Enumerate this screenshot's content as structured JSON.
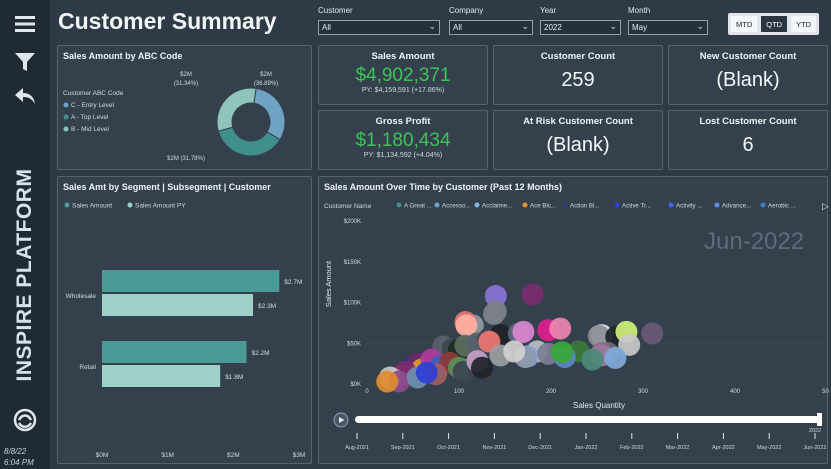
{
  "header": {
    "title": "Customer Summary"
  },
  "sidebar": {
    "brand": "INSPIRE PLATFORM",
    "date": "8/8/22",
    "time": "6:04 PM"
  },
  "filters": [
    {
      "label": "Customer",
      "value": "All"
    },
    {
      "label": "Company",
      "value": "All"
    },
    {
      "label": "Year",
      "value": "2022"
    },
    {
      "label": "Month",
      "value": "May"
    }
  ],
  "period_toggle": {
    "options": [
      "MTD",
      "QTD",
      "YTD"
    ],
    "selected": "QTD"
  },
  "cards": {
    "sales_amount": {
      "title": "Sales Amount",
      "value": "$4,902,371",
      "sub": "PY: $4,159,591 (+17.86%)"
    },
    "gross_profit": {
      "title": "Gross Profit",
      "value": "$1,180,434",
      "sub": "PY: $1,134,592 (+4.04%)"
    },
    "customer_count": {
      "title": "Customer Count",
      "value": "259"
    },
    "new_customer_count": {
      "title": "New Customer Count",
      "value": "(Blank)"
    },
    "at_risk_customer_count": {
      "title": "At Risk Customer Count",
      "value": "(Blank)"
    },
    "lost_customer_count": {
      "title": "Lost Customer Count",
      "value": "6"
    }
  },
  "donut": {
    "title": "Sales Amount by ABC Code",
    "legend_title": "Customer ABC Code",
    "labels": [
      {
        "value": "$2M",
        "pct": "(31.34%)"
      },
      {
        "value": "$2M",
        "pct": "(36.89%)"
      },
      {
        "value": "$2M (31.78%)",
        "pct": ""
      }
    ]
  },
  "scatter_panel": {
    "title": "Sales Amount Over Time by Customer (Past 12 Months)",
    "legend_label": "Customer Name",
    "watermark": "Jun-2022",
    "timeline": [
      "Aug-2021",
      "Sep-2021",
      "Oct-2021",
      "Nov-2021",
      "Dec-2021",
      "Jan-2022",
      "Feb-2022",
      "Mar-2022",
      "Apr-2022",
      "May-2022",
      "Jun-2022"
    ]
  },
  "chart_data": [
    {
      "type": "pie",
      "title": "Sales Amount by ABC Code",
      "categories": [
        "C - Entry Level",
        "A - Top Level",
        "B - Mid Level"
      ],
      "values": [
        31.34,
        36.89,
        31.78
      ],
      "colors": [
        "#6fa3c4",
        "#3f8f8a",
        "#8fc4bb"
      ]
    },
    {
      "type": "bar",
      "title": "Sales Amt by Segment | Subsegment | Customer",
      "categories": [
        "Wholesale",
        "Retail"
      ],
      "series": [
        {
          "name": "Sales Amount",
          "values": [
            2.7,
            2.2
          ],
          "labels": [
            "$2.7M",
            "$2.2M"
          ],
          "color": "#4a9b96"
        },
        {
          "name": "Sales Amount PY",
          "values": [
            2.3,
            1.8
          ],
          "labels": [
            "$2.3M",
            "$1.8M"
          ],
          "color": "#9fd0c8"
        }
      ],
      "xlim": [
        0,
        3
      ],
      "xticks": [
        "$0M",
        "$1M",
        "$2M",
        "$3M"
      ]
    },
    {
      "type": "scatter",
      "title": "Sales Amount Over Time by Customer (Past 12 Months)",
      "xlabel": "Sales Quantity",
      "ylabel": "Sales Amount",
      "xlim": [
        0,
        500
      ],
      "ylim": [
        0,
        200000
      ],
      "xticks": [
        0,
        100,
        200,
        300,
        400,
        500
      ],
      "xtick_labels": [
        "0",
        "100",
        "200",
        "300",
        "400",
        "500"
      ],
      "yticks": [
        0,
        50000,
        100000,
        150000,
        200000
      ],
      "ytick_labels": [
        "$0K",
        "$50K",
        "$100K",
        "$150K",
        "$200K"
      ],
      "series": [
        {
          "name": "A Great ...",
          "color": "#3f8f8a"
        },
        {
          "name": "Accesso...",
          "color": "#6fa3c4"
        },
        {
          "name": "Acclaime...",
          "color": "#7fb7d9"
        },
        {
          "name": "Ace Bic...",
          "color": "#f28c28"
        },
        {
          "name": "Action Bi...",
          "color": "#2b3f80"
        },
        {
          "name": "Active Tr...",
          "color": "#2d3fd6"
        },
        {
          "name": "Activity ...",
          "color": "#3a63f0"
        },
        {
          "name": "Advance...",
          "color": "#5b8ff0"
        },
        {
          "name": "Aerobic ...",
          "color": "#3b7ec9"
        }
      ],
      "points": [
        {
          "x": 140,
          "y": 108000,
          "c": "#8a74d8"
        },
        {
          "x": 180,
          "y": 110000,
          "c": "#7a2d6e"
        },
        {
          "x": 115,
          "y": 72000,
          "c": "#8f9aa4"
        },
        {
          "x": 138,
          "y": 86000,
          "c": "#7b8590"
        },
        {
          "x": 107,
          "y": 76000,
          "c": "#e07575"
        },
        {
          "x": 108,
          "y": 72000,
          "c": "#ffb0a0"
        },
        {
          "x": 140,
          "y": 89000,
          "c": "#7c8088"
        },
        {
          "x": 83,
          "y": 46000,
          "c": "#58616d"
        },
        {
          "x": 93,
          "y": 43000,
          "c": "#3c4650"
        },
        {
          "x": 100,
          "y": 42000,
          "c": "#1e2a22"
        },
        {
          "x": 107,
          "y": 47000,
          "c": "#5c6e60"
        },
        {
          "x": 120,
          "y": 50000,
          "c": "#565f6b"
        },
        {
          "x": 132,
          "y": 55000,
          "c": "#3b4552"
        },
        {
          "x": 145,
          "y": 60000,
          "c": "#1e2328"
        },
        {
          "x": 133,
          "y": 52000,
          "c": "#f07873"
        },
        {
          "x": 165,
          "y": 62000,
          "c": "#5c6a7a"
        },
        {
          "x": 170,
          "y": 64000,
          "c": "#d985d0"
        },
        {
          "x": 197,
          "y": 66000,
          "c": "#e0208e"
        },
        {
          "x": 210,
          "y": 68000,
          "c": "#ec85b0"
        },
        {
          "x": 255,
          "y": 60000,
          "c": "#e0e4e6"
        },
        {
          "x": 252,
          "y": 59000,
          "c": "#8b8e95"
        },
        {
          "x": 271,
          "y": 58000,
          "c": "#1d232a"
        },
        {
          "x": 282,
          "y": 64000,
          "c": "#d1f07a"
        },
        {
          "x": 310,
          "y": 62000,
          "c": "#6a5a78"
        },
        {
          "x": 185,
          "y": 40000,
          "c": "#b8c0c4"
        },
        {
          "x": 175,
          "y": 34000,
          "c": "#8aa3d8"
        },
        {
          "x": 230,
          "y": 40000,
          "c": "#3d7a3a"
        },
        {
          "x": 262,
          "y": 38000,
          "c": "#6e6f70"
        },
        {
          "x": 285,
          "y": 48000,
          "c": "#c9c9c9"
        },
        {
          "x": 255,
          "y": 38000,
          "c": "#8a6d8a"
        },
        {
          "x": 172,
          "y": 33000,
          "c": "#8c9aab"
        },
        {
          "x": 145,
          "y": 35000,
          "c": "#9a9ea3"
        },
        {
          "x": 197,
          "y": 37000,
          "c": "#7c7e95"
        },
        {
          "x": 215,
          "y": 33000,
          "c": "#5b88c2"
        },
        {
          "x": 212,
          "y": 39000,
          "c": "#38a838"
        },
        {
          "x": 255,
          "y": 35000,
          "c": "#9b7a9b"
        },
        {
          "x": 270,
          "y": 32000,
          "c": "#7faad9"
        },
        {
          "x": 245,
          "y": 30000,
          "c": "#4c8a7a"
        },
        {
          "x": 48,
          "y": 20000,
          "c": "#2a2f8a"
        },
        {
          "x": 55,
          "y": 25000,
          "c": "#6a2a6a"
        },
        {
          "x": 60,
          "y": 18000,
          "c": "#e0a030"
        },
        {
          "x": 70,
          "y": 30000,
          "c": "#b03aa0"
        },
        {
          "x": 80,
          "y": 22000,
          "c": "#3b5fbf"
        },
        {
          "x": 90,
          "y": 26000,
          "c": "#8e3a3a"
        },
        {
          "x": 38,
          "y": 10000,
          "c": "#d04a4a"
        },
        {
          "x": 42,
          "y": 15000,
          "c": "#7a2d6e"
        },
        {
          "x": 30,
          "y": 5000,
          "c": "#9b6fd0"
        },
        {
          "x": 25,
          "y": 8000,
          "c": "#c9c9c9"
        },
        {
          "x": 35,
          "y": 3000,
          "c": "#8a4a8a"
        },
        {
          "x": 22,
          "y": 3000,
          "c": "#e08c30"
        },
        {
          "x": 100,
          "y": 20000,
          "c": "#5b8f5b"
        },
        {
          "x": 105,
          "y": 15000,
          "c": "#3c4650"
        },
        {
          "x": 55,
          "y": 8000,
          "c": "#6e8fb0"
        },
        {
          "x": 75,
          "y": 12000,
          "c": "#a05f5f"
        },
        {
          "x": 65,
          "y": 14000,
          "c": "#2d3fd6"
        },
        {
          "x": 120,
          "y": 28000,
          "c": "#c5a0c8"
        },
        {
          "x": 125,
          "y": 20000,
          "c": "#1e2328"
        },
        {
          "x": 160,
          "y": 40000,
          "c": "#d0d0d0"
        }
      ]
    }
  ]
}
